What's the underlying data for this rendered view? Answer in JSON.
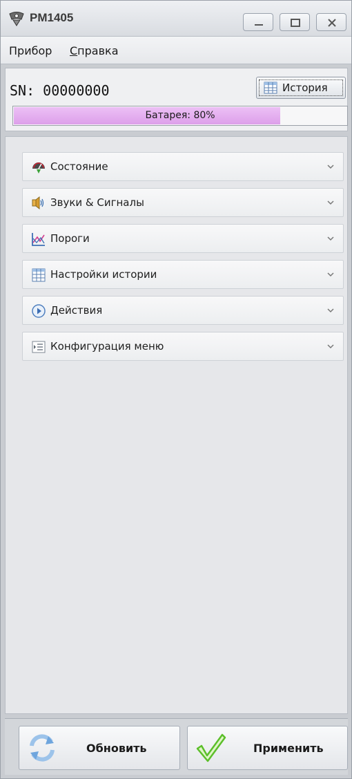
{
  "window": {
    "title": "PM1405"
  },
  "menu": {
    "items": [
      "Прибор",
      "Справка"
    ],
    "help_prefix": "С",
    "help_rest": "правка"
  },
  "device": {
    "serial_label": "SN: 00000000",
    "history_button": "История",
    "battery_label": "Батарея: 80%",
    "battery_level": 0.8
  },
  "sections": [
    {
      "label": "Состояние",
      "icon": "gauge-icon"
    },
    {
      "label": "Звуки & Сигналы",
      "icon": "speaker-icon"
    },
    {
      "label": "Пороги",
      "icon": "thresholds-chart-icon"
    },
    {
      "label": "Настройки истории",
      "icon": "table-icon"
    },
    {
      "label": "Действия",
      "icon": "play-icon"
    },
    {
      "label": "Конфигурация меню",
      "icon": "menu-list-icon"
    }
  ],
  "buttons": {
    "refresh": "Обновить",
    "apply": "Применить"
  },
  "colors": {
    "battery_fill": "#dd9fea",
    "apply_check": "#5cbf2a",
    "refresh_arrows": "#4a90d9"
  }
}
